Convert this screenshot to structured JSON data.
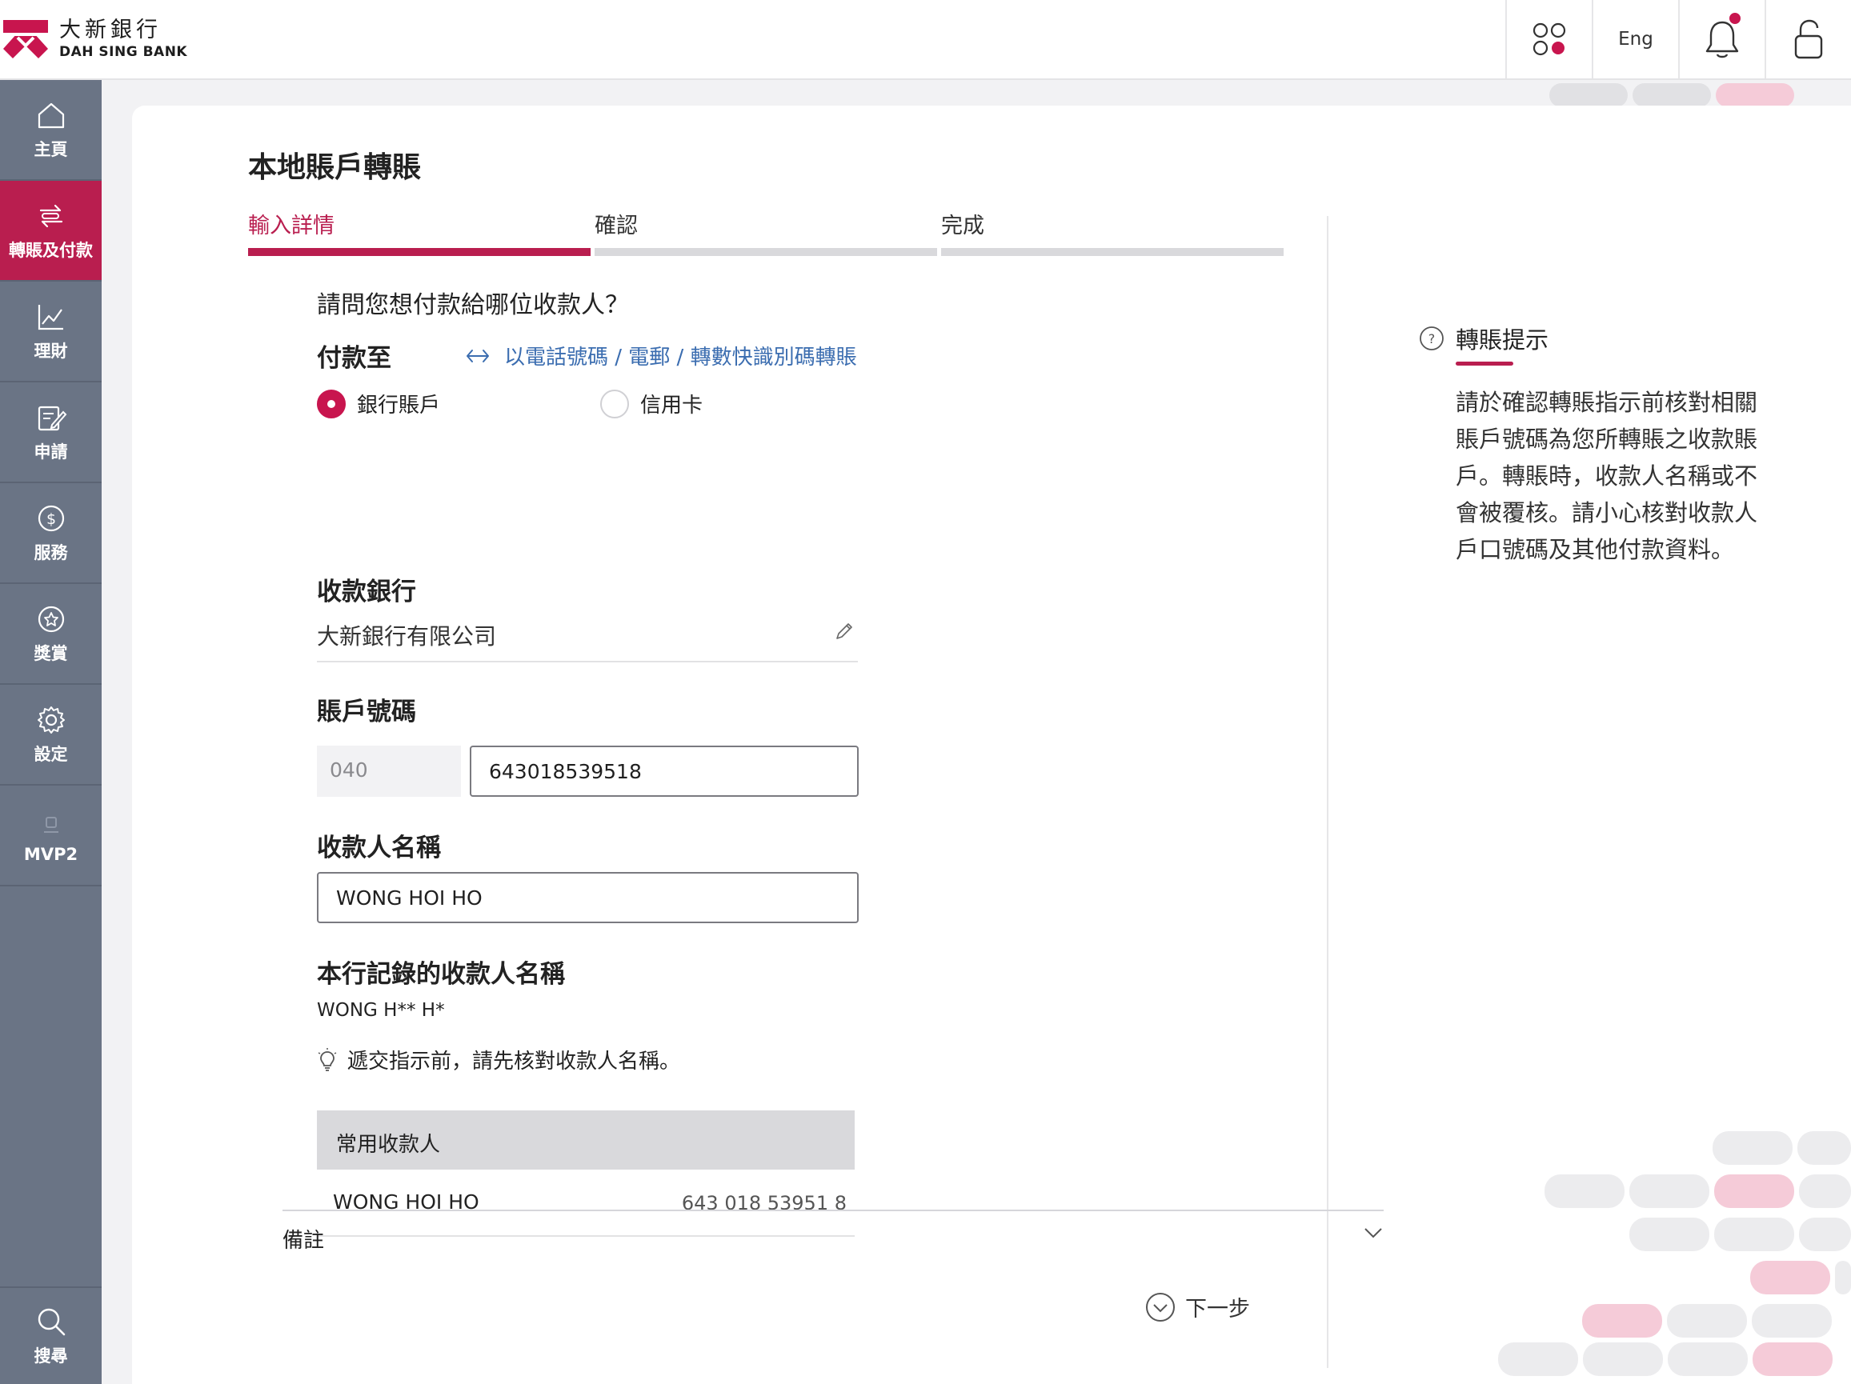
{
  "header": {
    "brand_cn": "大新銀行",
    "brand_en": "DAH SING BANK",
    "lang_label": "Eng"
  },
  "sidebar": {
    "items": [
      {
        "label": "主頁",
        "icon": "home-icon"
      },
      {
        "label": "轉賬及付款",
        "icon": "transfer-icon",
        "active": true
      },
      {
        "label": "理財",
        "icon": "chart-icon"
      },
      {
        "label": "申請",
        "icon": "application-icon"
      },
      {
        "label": "服務",
        "icon": "dollar-icon"
      },
      {
        "label": "獎賞",
        "icon": "star-icon"
      },
      {
        "label": "設定",
        "icon": "gear-icon"
      },
      {
        "label": "MVP2",
        "icon": "mvp-icon"
      }
    ],
    "search_label": "搜尋"
  },
  "page": {
    "title": "本地賬戶轉賬",
    "steps": [
      {
        "label": "輸入詳情",
        "active": true
      },
      {
        "label": "確認",
        "active": false
      },
      {
        "label": "完成",
        "active": false
      }
    ]
  },
  "form": {
    "question": "請問您想付款給哪位收款人？",
    "pay_to_label": "付款至",
    "switch_link": "以電話號碼 / 電郵 / 轉數快識別碼轉賬",
    "radio_bank": "銀行賬戶",
    "radio_card": "信用卡",
    "selected_type": "銀行賬戶",
    "bank_label": "收款銀行",
    "bank_value": "大新銀行有限公司",
    "account_label": "賬戶號碼",
    "account_prefix": "040",
    "account_number": "643018539518",
    "payee_label": "收款人名稱",
    "payee_value": "WONG HOI HO",
    "record_label": "本行記錄的收款人名稱",
    "record_value": "WONG H** H*",
    "tip": "遞交指示前，請先核對收款人名稱。",
    "favorites": {
      "header": "常用收款人",
      "rows": [
        {
          "name": "WONG HOI HO",
          "account": "643 018 53951 8"
        }
      ]
    },
    "remarks_label": "備註",
    "next_label": "下一步"
  },
  "tips": {
    "title": "轉賬提示",
    "body": "請於確認轉賬指示前核對相關賬戶號碼為您所轉賬之收款賬戶。轉賬時，收款人名稱或不會被覆核。請小心核對收款人戶口號碼及其他付款資料。"
  },
  "colors": {
    "brand": "#b91e4f",
    "sidebar": "#6a7485",
    "link": "#3b6db0"
  }
}
